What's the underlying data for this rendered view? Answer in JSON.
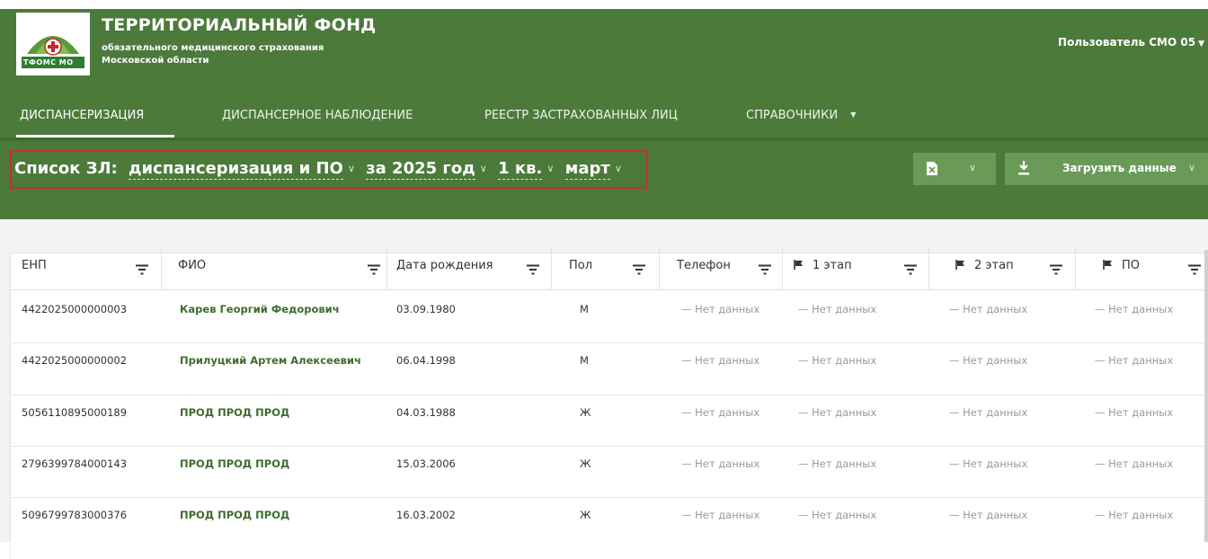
{
  "org": {
    "logo_text": "ТФОМС МО",
    "title": "ТЕРРИТОРИАЛЬНЫЙ ФОНД",
    "subtitle_line1": "обязательного медицинского страхования",
    "subtitle_line2": "Московской области"
  },
  "user_menu": {
    "label": "Пользователь СМО 05",
    "icon": "caret-down-icon"
  },
  "nav": {
    "tabs": [
      {
        "label": "ДИСПАНСЕРИЗАЦИЯ",
        "active": true
      },
      {
        "label": "ДИСПАНСЕРНОЕ НАБЛЮДЕНИЕ",
        "active": false
      },
      {
        "label": "РЕЕСТР ЗАСТРАХОВАННЫХ ЛИЦ",
        "active": false
      },
      {
        "label": "СПРАВОЧНИКИ",
        "active": false,
        "has_dropdown": true
      }
    ]
  },
  "filter": {
    "prefix": "Список ЗЛ:",
    "type": "диспансеризация и ПО",
    "year": "за 2025 год",
    "quarter": "1 кв.",
    "month": "март"
  },
  "toolbar": {
    "excel_icon": "excel-file-icon",
    "load_label": "Загрузить данные",
    "load_icon": "download-icon"
  },
  "table": {
    "columns": [
      {
        "label": "ЕНП",
        "icon": "filter-icon"
      },
      {
        "label": "ФИО",
        "icon": "filter-icon"
      },
      {
        "label": "Дата рождения",
        "icon": "filter-icon"
      },
      {
        "label": "Пол",
        "icon": "filter-icon"
      },
      {
        "label": "Телефон",
        "icon": "filter-icon"
      },
      {
        "label": "1 этап",
        "icon": "flag-icon"
      },
      {
        "label": "2 этап",
        "icon": "flag-icon"
      },
      {
        "label": "ПО",
        "icon": "flag-icon"
      }
    ],
    "rows": [
      {
        "enp": "4422025000000003",
        "fio": "Карев Георгий Федорович",
        "birth": "03.09.1980",
        "sex": "М",
        "phone": "— Нет данных",
        "stage1": "— Нет данных",
        "stage2": "— Нет данных",
        "po": "— Нет данных"
      },
      {
        "enp": "4422025000000002",
        "fio": "Прилуцкий Артем Алексеевич",
        "birth": "06.04.1998",
        "sex": "М",
        "phone": "— Нет данных",
        "stage1": "— Нет данных",
        "stage2": "— Нет данных",
        "po": "— Нет данных"
      },
      {
        "enp": "5056110895000189",
        "fio": "ПРОД ПРОД ПРОД",
        "birth": "04.03.1988",
        "sex": "Ж",
        "phone": "— Нет данных",
        "stage1": "— Нет данных",
        "stage2": "— Нет данных",
        "po": "— Нет данных"
      },
      {
        "enp": "2796399784000143",
        "fio": "ПРОД ПРОД ПРОД",
        "birth": "15.03.2006",
        "sex": "Ж",
        "phone": "— Нет данных",
        "stage1": "— Нет данных",
        "stage2": "— Нет данных",
        "po": "— Нет данных"
      },
      {
        "enp": "5096799783000376",
        "fio": "ПРОД ПРОД ПРОД",
        "birth": "16.03.2002",
        "sex": "Ж",
        "phone": "— Нет данных",
        "stage1": "— Нет данных",
        "stage2": "— Нет данных",
        "po": "— Нет данных"
      }
    ]
  },
  "colors": {
    "header_bg": "#4b7a3b",
    "button_bg": "#6a9a57",
    "highlight": "#d12b2b",
    "link_green": "#3e6c2e"
  }
}
